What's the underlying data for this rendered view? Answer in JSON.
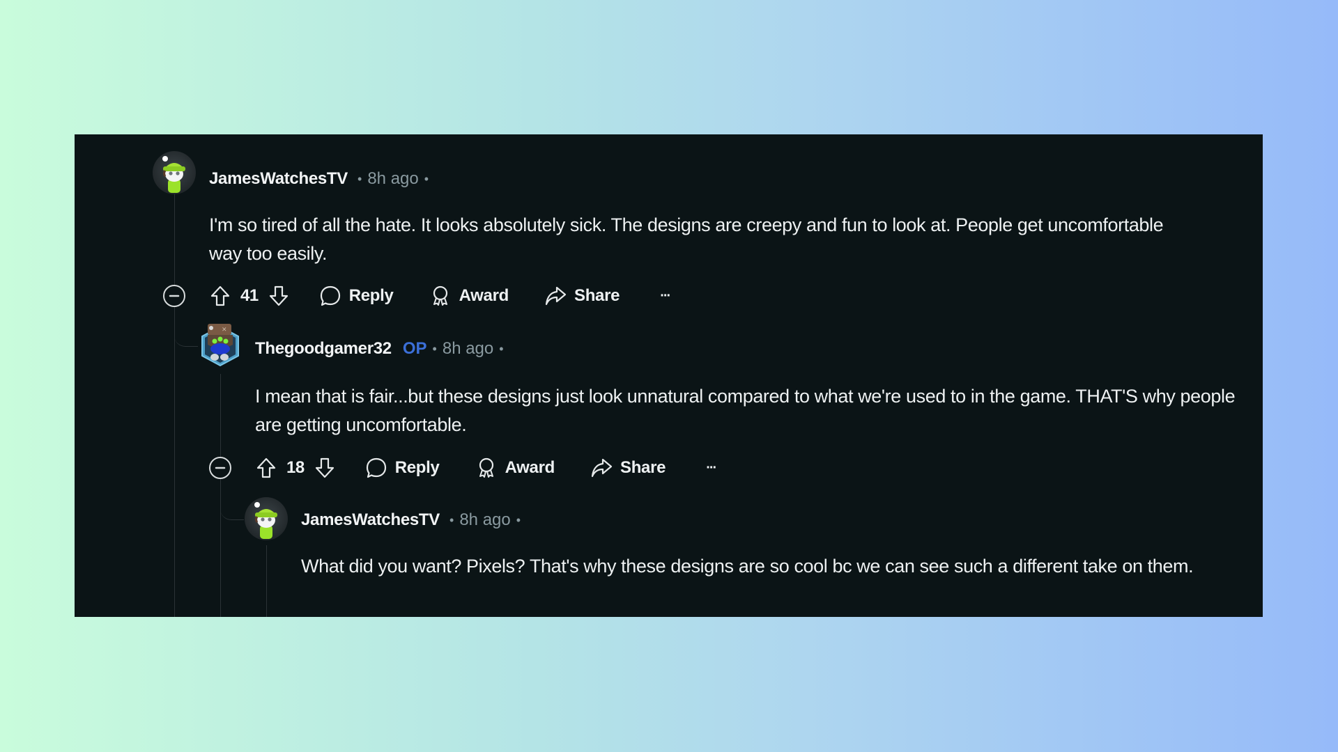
{
  "theme": {
    "card_bg": "#0b1416",
    "text_primary": "#eef1f2",
    "text_meta": "#8a9aa0",
    "op_badge": "#3b6fd8",
    "thread_line": "#2b3336"
  },
  "comments": [
    {
      "username": "JamesWatchesTV",
      "is_op": false,
      "time": "8h ago",
      "separator": "•",
      "avatar": "green-beanie-snoo-avatar",
      "body": "I'm so tired of all the hate. It looks absolutely sick. The designs are creepy and fun to look at. People get uncomfortable way too easily.",
      "votes": "41",
      "actions": {
        "reply": "Reply",
        "award": "Award",
        "share": "Share",
        "more": "···"
      }
    },
    {
      "username": "Thegoodgamer32",
      "is_op": true,
      "op_label": "OP",
      "time": "8h ago",
      "separator": "•",
      "avatar": "robot-hexagon-avatar",
      "body": "I mean that is fair...but these designs just look unnatural compared to what we're used to in the game. THAT'S why people are getting uncomfortable.",
      "votes": "18",
      "actions": {
        "reply": "Reply",
        "award": "Award",
        "share": "Share",
        "more": "···"
      }
    },
    {
      "username": "JamesWatchesTV",
      "is_op": false,
      "time": "8h ago",
      "separator": "•",
      "avatar": "green-beanie-snoo-avatar",
      "body": "What did you want? Pixels? That's why these designs are so cool bc we can see such a different take on them."
    }
  ]
}
